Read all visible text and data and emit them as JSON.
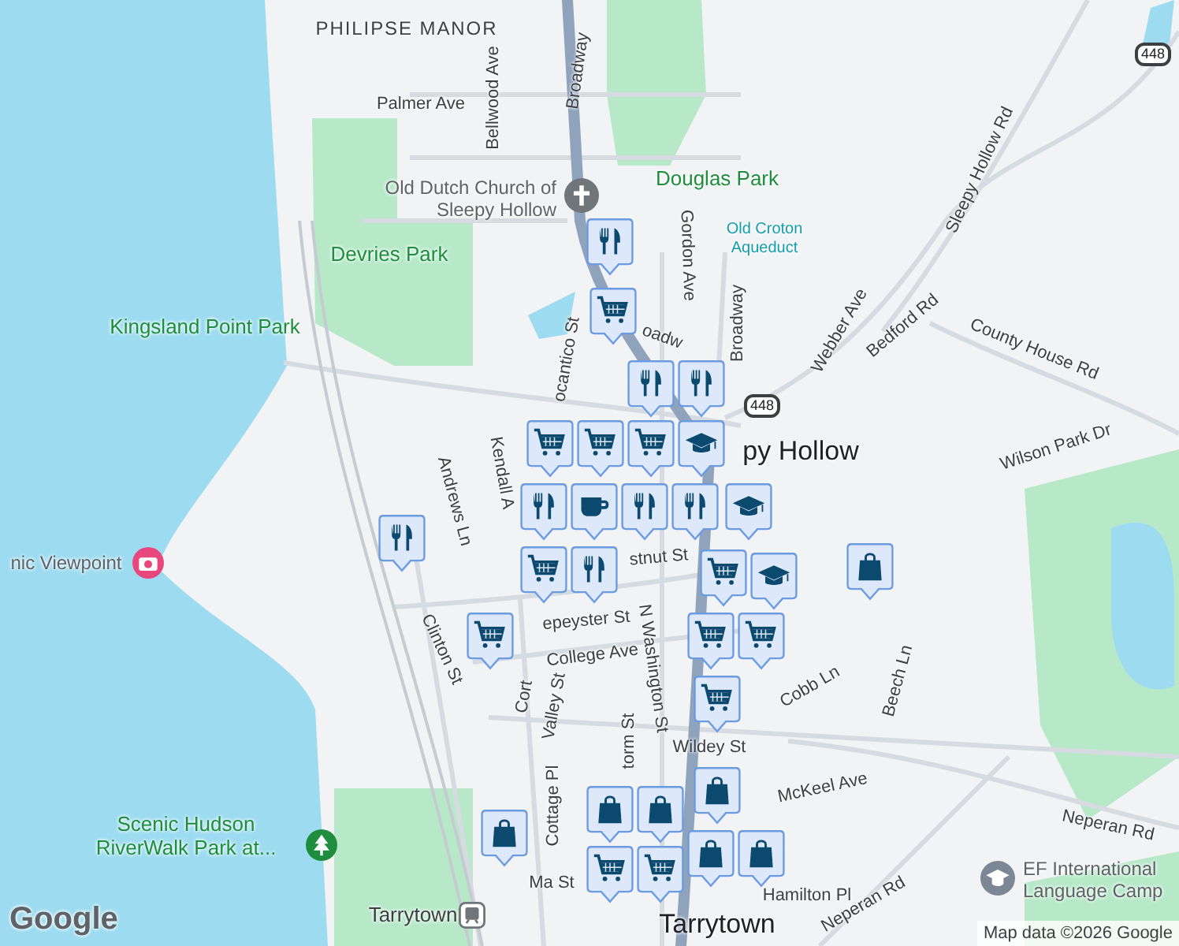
{
  "map": {
    "labels": [
      {
        "text": "PHILIPSE MANOR",
        "kind": "district"
      },
      {
        "text": "Broadway",
        "kind": "street"
      },
      {
        "text": "Bellwood Ave",
        "kind": "street"
      },
      {
        "text": "Palmer Ave",
        "kind": "street"
      },
      {
        "text": "Old Dutch Church of Sleepy Hollow",
        "kind": "poi"
      },
      {
        "text": "Douglas Park",
        "kind": "park"
      },
      {
        "text": "Devries Park",
        "kind": "park"
      },
      {
        "text": "Old Croton Aqueduct",
        "kind": "trail"
      },
      {
        "text": "Gordon Ave",
        "kind": "street"
      },
      {
        "text": "Broadway",
        "kind": "street"
      },
      {
        "text": "Kingsland Point Park",
        "kind": "park"
      },
      {
        "text": "Webber Ave",
        "kind": "street"
      },
      {
        "text": "Sleepy Hollow Rd",
        "kind": "street"
      },
      {
        "text": "Bedford Rd",
        "kind": "street"
      },
      {
        "text": "County House Rd",
        "kind": "street"
      },
      {
        "text": "Wilson Park Dr",
        "kind": "street"
      },
      {
        "text": "ocantico St",
        "kind": "street"
      },
      {
        "text": "oadw",
        "kind": "street"
      },
      {
        "text": "py Hollow",
        "kind": "town"
      },
      {
        "text": "Andrews Ln",
        "kind": "street"
      },
      {
        "text": "Kendall A",
        "kind": "street"
      },
      {
        "text": "stnut St",
        "kind": "street"
      },
      {
        "text": "epeyster St",
        "kind": "street"
      },
      {
        "text": "College Ave",
        "kind": "street"
      },
      {
        "text": "N Washington St",
        "kind": "street"
      },
      {
        "text": "Clinton St",
        "kind": "street"
      },
      {
        "text": "Cort",
        "kind": "street"
      },
      {
        "text": "Valley St",
        "kind": "street"
      },
      {
        "text": "Cobb Ln",
        "kind": "street"
      },
      {
        "text": "Beech Ln",
        "kind": "street"
      },
      {
        "text": "Wildey St",
        "kind": "street"
      },
      {
        "text": "Cottage Pl",
        "kind": "street"
      },
      {
        "text": "torm St",
        "kind": "street"
      },
      {
        "text": "McKeel Ave",
        "kind": "street"
      },
      {
        "text": "Neperan Rd",
        "kind": "street"
      },
      {
        "text": "Scenic Hudson RiverWalk Park at...",
        "kind": "park"
      },
      {
        "text": "Ma St",
        "kind": "street"
      },
      {
        "text": "Hamilton Pl",
        "kind": "street"
      },
      {
        "text": "EF International Language Camp",
        "kind": "poi"
      },
      {
        "text": "Neperan Rd",
        "kind": "street"
      },
      {
        "text": "Tarrytown",
        "kind": "town"
      },
      {
        "text": "Tarrytown",
        "kind": "station"
      },
      {
        "text": "nic Viewpoint",
        "kind": "poi"
      }
    ],
    "shields": [
      "448",
      "448"
    ],
    "markers": [
      {
        "kind": "dining"
      },
      {
        "kind": "grocery"
      },
      {
        "kind": "dining"
      },
      {
        "kind": "grocery"
      },
      {
        "kind": "grocery"
      },
      {
        "kind": "dining"
      },
      {
        "kind": "school"
      },
      {
        "kind": "grocery"
      },
      {
        "kind": "dining"
      },
      {
        "kind": "coffee"
      },
      {
        "kind": "dining"
      },
      {
        "kind": "dining"
      },
      {
        "kind": "dining"
      },
      {
        "kind": "dining"
      },
      {
        "kind": "grocery"
      },
      {
        "kind": "school"
      },
      {
        "kind": "grocery"
      },
      {
        "kind": "school"
      },
      {
        "kind": "grocery"
      },
      {
        "kind": "grocery"
      },
      {
        "kind": "grocery"
      },
      {
        "kind": "grocery"
      },
      {
        "kind": "shopping"
      },
      {
        "kind": "shopping"
      },
      {
        "kind": "shopping"
      },
      {
        "kind": "shopping"
      },
      {
        "kind": "shopping"
      },
      {
        "kind": "shopping"
      },
      {
        "kind": "shopping"
      },
      {
        "kind": "grocery"
      },
      {
        "kind": "grocery"
      }
    ],
    "logo": "Google",
    "attribution": "Map data ©2026 Google"
  }
}
